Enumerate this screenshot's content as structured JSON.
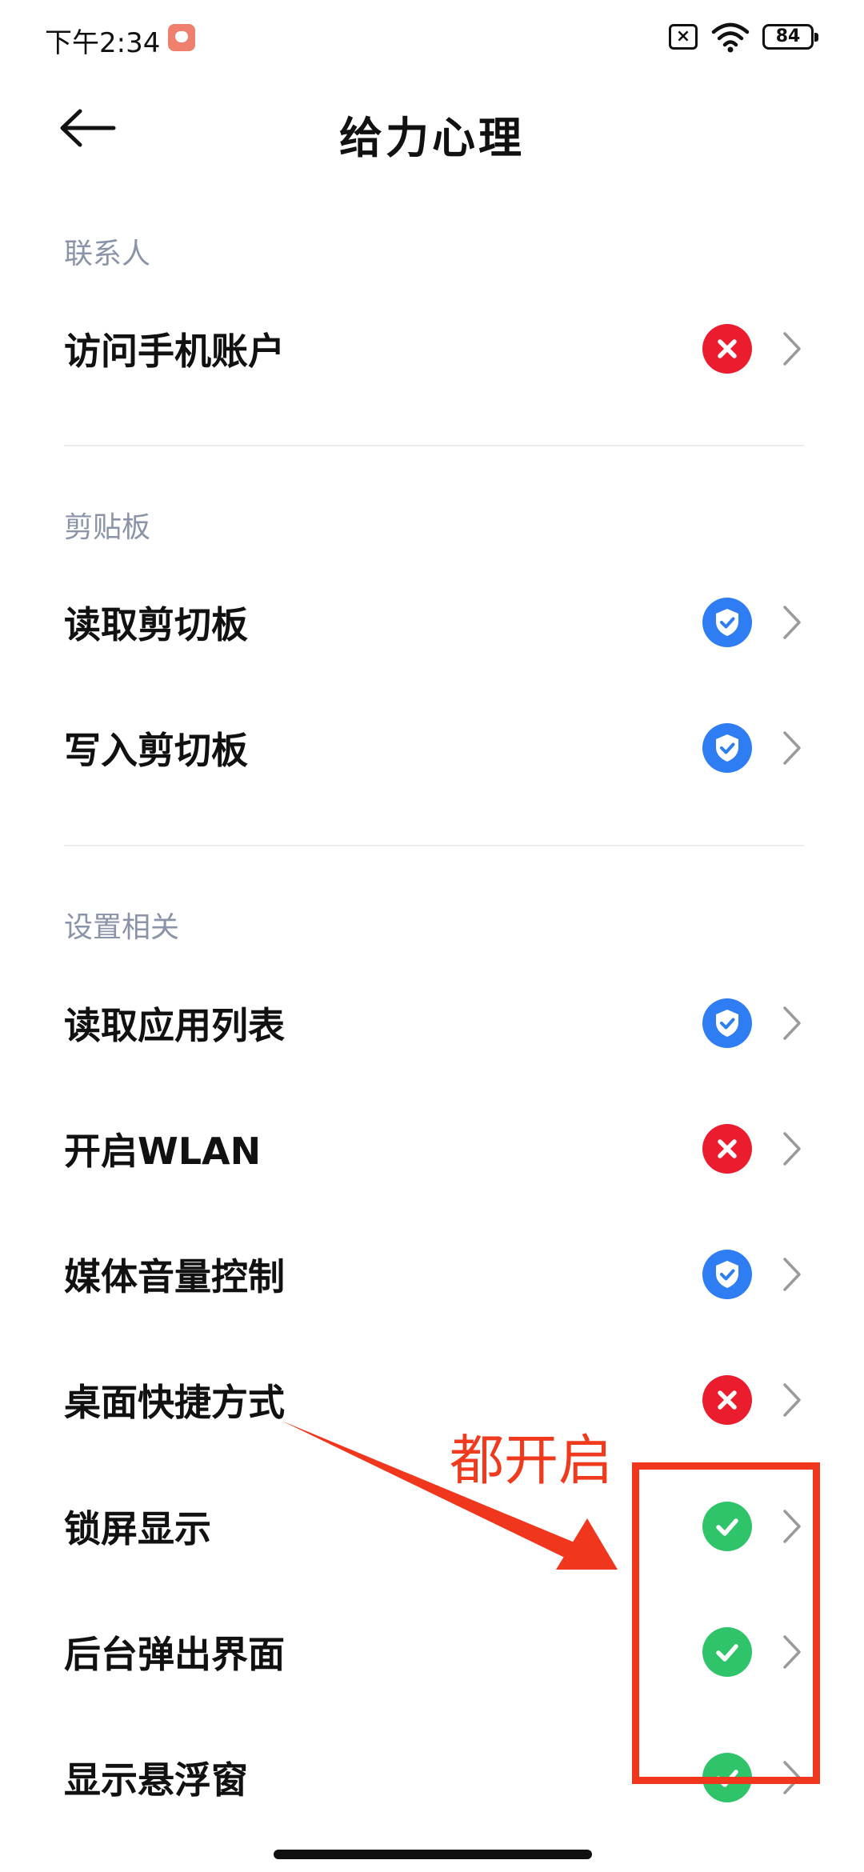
{
  "status_bar": {
    "time": "下午2:34",
    "sim_label": "×",
    "battery": "84"
  },
  "header": {
    "title": "给力心理"
  },
  "sections": [
    {
      "title": "联系人",
      "items": [
        {
          "label": "访问手机账户",
          "status": "denied"
        }
      ]
    },
    {
      "title": "剪贴板",
      "items": [
        {
          "label": "读取剪切板",
          "status": "ask"
        },
        {
          "label": "写入剪切板",
          "status": "ask"
        }
      ]
    },
    {
      "title": "设置相关",
      "items": [
        {
          "label": "读取应用列表",
          "status": "ask"
        },
        {
          "label": "开启WLAN",
          "status": "denied"
        },
        {
          "label": "媒体音量控制",
          "status": "ask"
        },
        {
          "label": "桌面快捷方式",
          "status": "denied"
        },
        {
          "label": "锁屏显示",
          "status": "allowed"
        },
        {
          "label": "后台弹出界面",
          "status": "allowed"
        },
        {
          "label": "显示悬浮窗",
          "status": "allowed"
        }
      ]
    }
  ],
  "annotation": {
    "text": "都开启",
    "color": "#f0361c"
  },
  "colors": {
    "denied": "#ea1c2e",
    "ask": "#2f7df2",
    "allowed": "#2fc36a",
    "section_title": "#8a93a8"
  },
  "icons": {
    "back": "arrow-left-icon",
    "denied": "x-circle-icon",
    "ask": "shield-check-icon",
    "allowed": "check-circle-icon",
    "chevron": "chevron-right-icon"
  }
}
